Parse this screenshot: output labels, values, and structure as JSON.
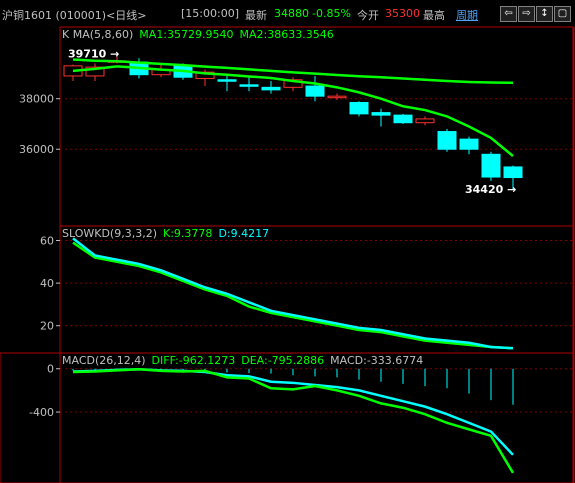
{
  "header": {
    "title": "沪铜1601 (010001)<日线>",
    "time": "[15:00:00]",
    "latest_label": "最新",
    "latest_value": "34880",
    "change": "-0.85%",
    "open_label": "今开",
    "open_value": "35300",
    "high_label": "最高",
    "period_label": "周期",
    "buttons": [
      "⇦",
      "⇨",
      "↕",
      "▢"
    ]
  },
  "colors": {
    "up": "#ff3030",
    "down": "#00ffff",
    "ma1": "#ffffff",
    "ma2": "#00ff00",
    "latest": "#00ff00",
    "open": "#ff3030",
    "border": "#b00000",
    "k_line": "#00ffff",
    "d_line": "#00ff00",
    "macd_bar": "#00ffff"
  },
  "chart_data": [
    {
      "type": "candlestick",
      "title": "K  MA(5,8,60)",
      "legend": [
        {
          "name": "MA1",
          "value": "35729.9540"
        },
        {
          "name": "MA2",
          "value": "38633.3546"
        }
      ],
      "ylim": [
        33200,
        40600
      ],
      "yticks": [
        36000,
        38000
      ],
      "high_label": "39710",
      "low_label": "34420",
      "candles": [
        {
          "o": 38900,
          "c": 39300,
          "h": 39350,
          "l": 38700
        },
        {
          "o": 38900,
          "c": 39250,
          "h": 39400,
          "l": 38700
        },
        {
          "o": 39450,
          "c": 39500,
          "h": 39710,
          "l": 39400
        },
        {
          "o": 39450,
          "c": 38950,
          "h": 39600,
          "l": 38800
        },
        {
          "o": 38950,
          "c": 39150,
          "h": 39350,
          "l": 38850
        },
        {
          "o": 39300,
          "c": 38850,
          "h": 39400,
          "l": 38750
        },
        {
          "o": 38800,
          "c": 39050,
          "h": 39150,
          "l": 38500
        },
        {
          "o": 38750,
          "c": 38700,
          "h": 38900,
          "l": 38300
        },
        {
          "o": 38550,
          "c": 38500,
          "h": 38900,
          "l": 38300
        },
        {
          "o": 38450,
          "c": 38350,
          "h": 38700,
          "l": 38200
        },
        {
          "o": 38450,
          "c": 38750,
          "h": 38850,
          "l": 38300
        },
        {
          "o": 38500,
          "c": 38100,
          "h": 38900,
          "l": 37900
        },
        {
          "o": 38050,
          "c": 38100,
          "h": 38200,
          "l": 37950
        },
        {
          "o": 37850,
          "c": 37400,
          "h": 37900,
          "l": 37300
        },
        {
          "o": 37450,
          "c": 37350,
          "h": 37600,
          "l": 36900
        },
        {
          "o": 37350,
          "c": 37050,
          "h": 37400,
          "l": 37000
        },
        {
          "o": 37050,
          "c": 37200,
          "h": 37300,
          "l": 36950
        },
        {
          "o": 36700,
          "c": 36000,
          "h": 36800,
          "l": 35900
        },
        {
          "o": 36400,
          "c": 36000,
          "h": 36500,
          "l": 35800
        },
        {
          "o": 35800,
          "c": 34900,
          "h": 35900,
          "l": 34750
        },
        {
          "o": 35300,
          "c": 34880,
          "h": 35350,
          "l": 34420
        }
      ],
      "series": [
        {
          "name": "MA1",
          "values": [
            39100,
            39180,
            39280,
            39220,
            39150,
            39100,
            39000,
            38950,
            38880,
            38820,
            38700,
            38600,
            38450,
            38250,
            38000,
            37700,
            37550,
            37300,
            36900,
            36450,
            35730
          ]
        },
        {
          "name": "MA2",
          "values": [
            39550,
            39500,
            39480,
            39430,
            39380,
            39330,
            39270,
            39220,
            39160,
            39100,
            39040,
            38990,
            38940,
            38890,
            38850,
            38800,
            38750,
            38700,
            38660,
            38640,
            38630
          ]
        }
      ]
    },
    {
      "type": "line",
      "title": "SLOWKD(9,3,3,2)",
      "legend": [
        {
          "name": "K",
          "value": "9.3778"
        },
        {
          "name": "D",
          "value": "9.4217"
        }
      ],
      "ylim": [
        10,
        64
      ],
      "yticks": [
        20,
        40,
        60
      ],
      "series": [
        {
          "name": "K",
          "values": [
            61,
            53,
            51,
            49,
            46,
            42,
            38,
            35,
            31,
            27,
            25,
            23,
            21,
            19,
            18,
            16,
            14,
            13,
            12,
            10,
            9.4
          ]
        },
        {
          "name": "D",
          "values": [
            59,
            52,
            50,
            48,
            45,
            41,
            37,
            34,
            29,
            26,
            24,
            22,
            20,
            18,
            17,
            15,
            13,
            12,
            11,
            10,
            9.4
          ]
        }
      ]
    },
    {
      "type": "bar",
      "title": "MACD(26,12,4)",
      "legend": [
        {
          "name": "DIFF",
          "value": "-962.1273"
        },
        {
          "name": "DEA",
          "value": "-795.2886"
        },
        {
          "name": "MACD",
          "value": "-333.6774"
        }
      ],
      "ylim": [
        -1000,
        90
      ],
      "yticks": [
        0,
        -400
      ],
      "macd": [
        -15,
        -10,
        -5,
        -5,
        -20,
        -25,
        -30,
        -35,
        -40,
        -45,
        -60,
        -70,
        -80,
        -100,
        -120,
        -140,
        -160,
        -180,
        -230,
        -290,
        -333
      ],
      "series": [
        {
          "name": "DIFF",
          "values": [
            -30,
            -25,
            -15,
            -5,
            -20,
            -25,
            -20,
            -80,
            -90,
            -180,
            -190,
            -160,
            -200,
            -250,
            -320,
            -360,
            -420,
            -500,
            -560,
            -620,
            -962
          ]
        },
        {
          "name": "DEA",
          "values": [
            -25,
            -20,
            -10,
            -5,
            -15,
            -20,
            -30,
            -60,
            -70,
            -120,
            -130,
            -150,
            -170,
            -200,
            -250,
            -300,
            -350,
            -420,
            -500,
            -580,
            -795
          ]
        }
      ]
    }
  ]
}
